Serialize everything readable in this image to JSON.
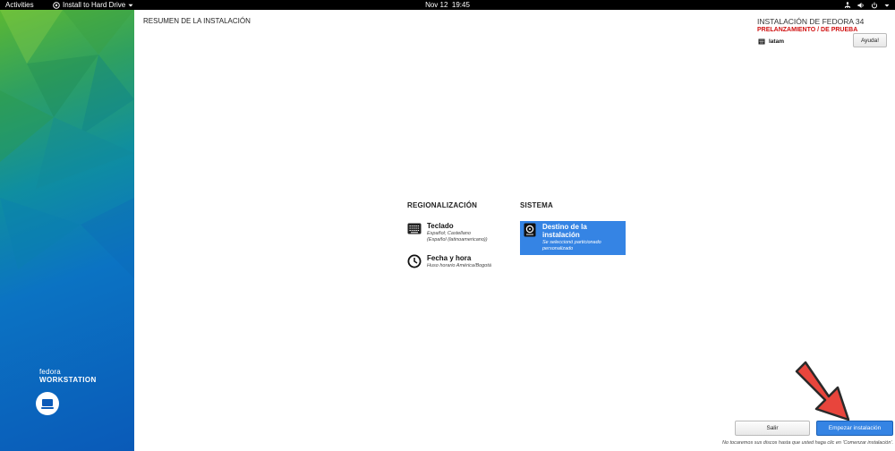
{
  "topbar": {
    "activities": "Activities",
    "app_name": "Install to Hard Drive",
    "clock_date": "Nov 12",
    "clock_time": "19:45",
    "tray_icons": [
      "network-icon",
      "volume-icon",
      "power-icon",
      "chevron-down-icon"
    ]
  },
  "sidebar": {
    "brand_name": "fedora",
    "edition": "WORKSTATION"
  },
  "header": {
    "title": "RESUMEN DE LA INSTALACIÓN",
    "product": "INSTALACIÓN DE FEDORA 34",
    "prerelease": "PRELANZAMIENTO / DE PRUEBA",
    "keyboard_layout": "latam",
    "help_label": "Ayuda!"
  },
  "sections": {
    "localization": {
      "title": "REGIONALIZACIÓN",
      "spokes": [
        {
          "name": "Teclado",
          "status": [
            "Español; Castellano",
            "(Español (latinoamericano))"
          ],
          "icon": "keyboard-icon"
        },
        {
          "name": "Fecha y hora",
          "status": [
            "Huso horario América/Bogotá"
          ],
          "icon": "clock-icon"
        }
      ]
    },
    "system": {
      "title": "SISTEMA",
      "spokes": [
        {
          "name": "Destino de la instalación",
          "status": [
            "Se seleccionó particionado",
            "personalizado"
          ],
          "icon": "disk-icon"
        }
      ]
    }
  },
  "footer": {
    "quit_label": "Salir",
    "begin_label": "Empezar instalación",
    "note": "No tocaremos sus discos hasta que usted haga clic en 'Comenzar instalación'."
  },
  "colors": {
    "accent": "#3584e4",
    "prerelease": "#d01010",
    "annotation_arrow": "#e8453c"
  }
}
